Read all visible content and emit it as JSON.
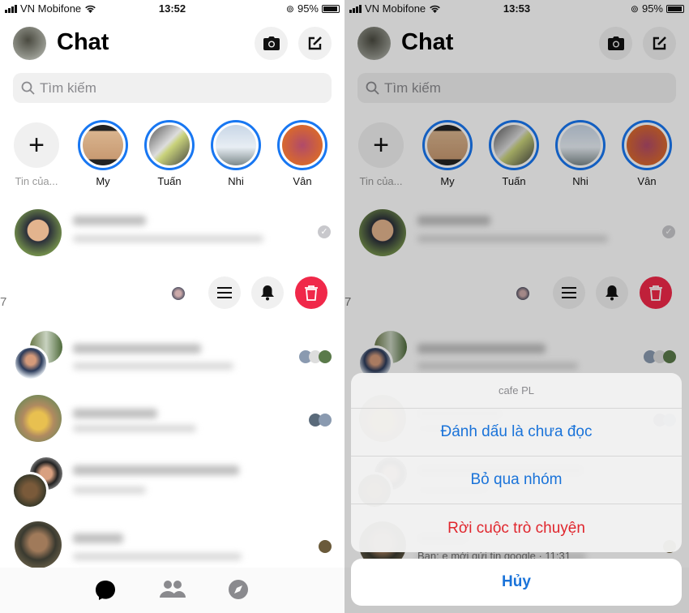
{
  "panels": [
    {
      "status": {
        "carrier": "VN Mobifone",
        "time": "13:52",
        "battery": "95%"
      }
    },
    {
      "status": {
        "carrier": "VN Mobifone",
        "time": "13:53",
        "battery": "95%"
      }
    }
  ],
  "header": {
    "title": "Chat"
  },
  "search": {
    "placeholder": "Tìm kiếm"
  },
  "stories": [
    {
      "label": "Tin của..."
    },
    {
      "label": "My"
    },
    {
      "label": "Tuấn"
    },
    {
      "label": "Nhi"
    },
    {
      "label": "Vân"
    }
  ],
  "swiped_row": {
    "partial_text": "7"
  },
  "action_sheet": {
    "title": "cafe PL",
    "items": [
      {
        "label": "Đánh dấu là chưa đọc",
        "color": "#1a73d9"
      },
      {
        "label": "Bỏ qua nhóm",
        "color": "#1a73d9"
      },
      {
        "label": "Rời cuộc trò chuyện",
        "color": "#e0262d"
      }
    ],
    "cancel": "Hủy"
  },
  "peek_text": "Bạn: e mới gửi tin google · 11:31",
  "colors": {
    "accent": "#1877f2",
    "delete": "#f02849",
    "destructive": "#e0262d"
  }
}
